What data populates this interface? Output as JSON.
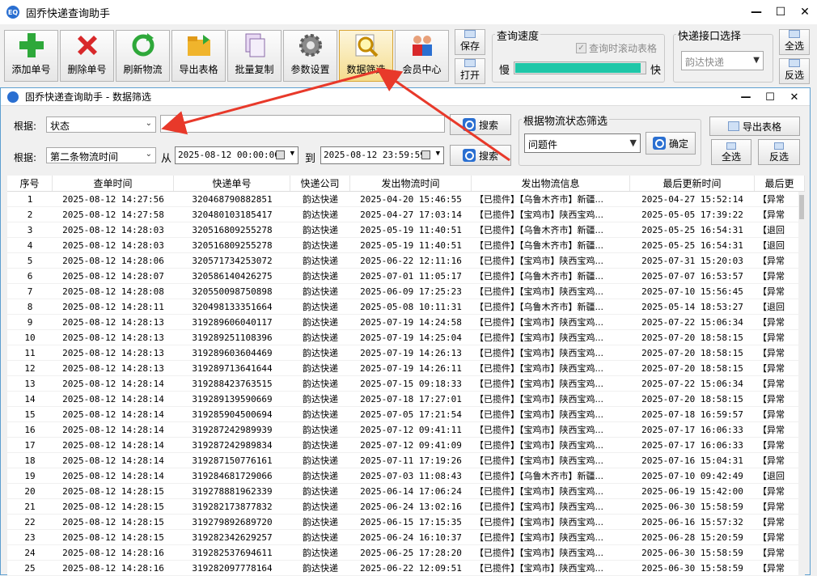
{
  "window": {
    "title": "固乔快递查询助手",
    "icon_label": "EQ"
  },
  "toolbar": {
    "buttons": [
      {
        "label": "添加单号",
        "icon": "green-plus-icon"
      },
      {
        "label": "删除单号",
        "icon": "red-x-icon"
      },
      {
        "label": "刷新物流",
        "icon": "refresh-icon"
      },
      {
        "label": "导出表格",
        "icon": "folder-icon"
      },
      {
        "label": "批量复制",
        "icon": "copy-icon"
      },
      {
        "label": "参数设置",
        "icon": "gear-icon"
      },
      {
        "label": "数据筛选",
        "icon": "magnifier-icon"
      },
      {
        "label": "会员中心",
        "icon": "users-icon"
      }
    ],
    "save_label": "保存",
    "open_label": "打开",
    "speed_group": {
      "label": "查询速度",
      "scroll_checkbox": "查询时滚动表格",
      "slow": "慢",
      "fast": "快",
      "speed_value": 0.97
    },
    "api_group": {
      "label": "快递接口选择",
      "selected": "韵达快递"
    },
    "select_all": "全选",
    "invert": "反选"
  },
  "dialog": {
    "title": "固乔快递查询助手 - 数据筛选",
    "basis_label": "根据:",
    "basis1": "状态",
    "basis2": "第二条物流时间",
    "from_label": "从",
    "to_label": "到",
    "date_from": "2025-08-12 00:00:00",
    "date_to": "2025-08-12 23:59:59",
    "search_label": "搜索",
    "status_group_label": "根据物流状态筛选",
    "status_selected": "问题件",
    "confirm_label": "确定",
    "export_label": "导出表格",
    "select_all": "全选",
    "invert": "反选",
    "columns": [
      "序号",
      "查单时间",
      "快递单号",
      "快递公司",
      "发出物流时间",
      "发出物流信息",
      "最后更新时间",
      "最后更"
    ],
    "rows": [
      [
        "1",
        "2025-08-12 14:27:56",
        "320468790882851",
        "韵达快递",
        "2025-04-20 15:46:55",
        "【已揽件】【乌鲁木齐市】新疆...",
        "2025-04-27 15:52:14",
        "【异常"
      ],
      [
        "2",
        "2025-08-12 14:27:58",
        "320480103185417",
        "韵达快递",
        "2025-04-27 17:03:14",
        "【已揽件】【宝鸡市】陕西宝鸡...",
        "2025-05-05 17:39:22",
        "【异常"
      ],
      [
        "3",
        "2025-08-12 14:28:03",
        "320516809255278",
        "韵达快递",
        "2025-05-19 11:40:51",
        "【已揽件】【乌鲁木齐市】新疆...",
        "2025-05-25 16:54:31",
        "【退回"
      ],
      [
        "4",
        "2025-08-12 14:28:03",
        "320516809255278",
        "韵达快递",
        "2025-05-19 11:40:51",
        "【已揽件】【乌鲁木齐市】新疆...",
        "2025-05-25 16:54:31",
        "【退回"
      ],
      [
        "5",
        "2025-08-12 14:28:06",
        "320571734253072",
        "韵达快递",
        "2025-06-22 12:11:16",
        "【已揽件】【宝鸡市】陕西宝鸡...",
        "2025-07-31 15:20:03",
        "【异常"
      ],
      [
        "6",
        "2025-08-12 14:28:07",
        "320586140426275",
        "韵达快递",
        "2025-07-01 11:05:17",
        "【已揽件】【乌鲁木齐市】新疆...",
        "2025-07-07 16:53:57",
        "【异常"
      ],
      [
        "7",
        "2025-08-12 14:28:08",
        "320550098750898",
        "韵达快递",
        "2025-06-09 17:25:23",
        "【已揽件】【宝鸡市】陕西宝鸡...",
        "2025-07-10 15:56:45",
        "【异常"
      ],
      [
        "8",
        "2025-08-12 14:28:11",
        "320498133351664",
        "韵达快递",
        "2025-05-08 10:11:31",
        "【已揽件】【乌鲁木齐市】新疆...",
        "2025-05-14 18:53:27",
        "【退回"
      ],
      [
        "9",
        "2025-08-12 14:28:13",
        "319289606040117",
        "韵达快递",
        "2025-07-19 14:24:58",
        "【已揽件】【宝鸡市】陕西宝鸡...",
        "2025-07-22 15:06:34",
        "【异常"
      ],
      [
        "10",
        "2025-08-12 14:28:13",
        "319289251108396",
        "韵达快递",
        "2025-07-19 14:25:04",
        "【已揽件】【宝鸡市】陕西宝鸡...",
        "2025-07-20 18:58:15",
        "【异常"
      ],
      [
        "11",
        "2025-08-12 14:28:13",
        "319289603604469",
        "韵达快递",
        "2025-07-19 14:26:13",
        "【已揽件】【宝鸡市】陕西宝鸡...",
        "2025-07-20 18:58:15",
        "【异常"
      ],
      [
        "12",
        "2025-08-12 14:28:13",
        "319289713641644",
        "韵达快递",
        "2025-07-19 14:26:11",
        "【已揽件】【宝鸡市】陕西宝鸡...",
        "2025-07-20 18:58:15",
        "【异常"
      ],
      [
        "13",
        "2025-08-12 14:28:14",
        "319288423763515",
        "韵达快递",
        "2025-07-15 09:18:33",
        "【已揽件】【宝鸡市】陕西宝鸡...",
        "2025-07-22 15:06:34",
        "【异常"
      ],
      [
        "14",
        "2025-08-12 14:28:14",
        "319289139590669",
        "韵达快递",
        "2025-07-18 17:27:01",
        "【已揽件】【宝鸡市】陕西宝鸡...",
        "2025-07-20 18:58:15",
        "【异常"
      ],
      [
        "15",
        "2025-08-12 14:28:14",
        "319285904500694",
        "韵达快递",
        "2025-07-05 17:21:54",
        "【已揽件】【宝鸡市】陕西宝鸡...",
        "2025-07-18 16:59:57",
        "【异常"
      ],
      [
        "16",
        "2025-08-12 14:28:14",
        "319287242989939",
        "韵达快递",
        "2025-07-12 09:41:11",
        "【已揽件】【宝鸡市】陕西宝鸡...",
        "2025-07-17 16:06:33",
        "【异常"
      ],
      [
        "17",
        "2025-08-12 14:28:14",
        "319287242989834",
        "韵达快递",
        "2025-07-12 09:41:09",
        "【已揽件】【宝鸡市】陕西宝鸡...",
        "2025-07-17 16:06:33",
        "【异常"
      ],
      [
        "18",
        "2025-08-12 14:28:14",
        "319287150776161",
        "韵达快递",
        "2025-07-11 17:19:26",
        "【已揽件】【宝鸡市】陕西宝鸡...",
        "2025-07-16 15:04:31",
        "【异常"
      ],
      [
        "19",
        "2025-08-12 14:28:14",
        "319284681729066",
        "韵达快递",
        "2025-07-03 11:08:43",
        "【已揽件】【乌鲁木齐市】新疆...",
        "2025-07-10 09:42:49",
        "【退回"
      ],
      [
        "20",
        "2025-08-12 14:28:15",
        "319278881962339",
        "韵达快递",
        "2025-06-14 17:06:24",
        "【已揽件】【宝鸡市】陕西宝鸡...",
        "2025-06-19 15:42:00",
        "【异常"
      ],
      [
        "21",
        "2025-08-12 14:28:15",
        "319282173877832",
        "韵达快递",
        "2025-06-24 13:02:16",
        "【已揽件】【宝鸡市】陕西宝鸡...",
        "2025-06-30 15:58:59",
        "【异常"
      ],
      [
        "22",
        "2025-08-12 14:28:15",
        "319279892689720",
        "韵达快递",
        "2025-06-15 17:15:35",
        "【已揽件】【宝鸡市】陕西宝鸡...",
        "2025-06-16 15:57:32",
        "【异常"
      ],
      [
        "23",
        "2025-08-12 14:28:15",
        "319282342629257",
        "韵达快递",
        "2025-06-24 16:10:37",
        "【已揽件】【宝鸡市】陕西宝鸡...",
        "2025-06-28 15:20:59",
        "【异常"
      ],
      [
        "24",
        "2025-08-12 14:28:16",
        "319282537694611",
        "韵达快递",
        "2025-06-25 17:28:20",
        "【已揽件】【宝鸡市】陕西宝鸡...",
        "2025-06-30 15:58:59",
        "【异常"
      ],
      [
        "25",
        "2025-08-12 14:28:16",
        "319282097778164",
        "韵达快递",
        "2025-06-22 12:09:51",
        "【已揽件】【宝鸡市】陕西宝鸡...",
        "2025-06-30 15:58:59",
        "【异常"
      ]
    ]
  },
  "colors": {
    "accent": "#2a6fd1",
    "arrow": "#e8392a",
    "progress": "#1fc7a8"
  }
}
